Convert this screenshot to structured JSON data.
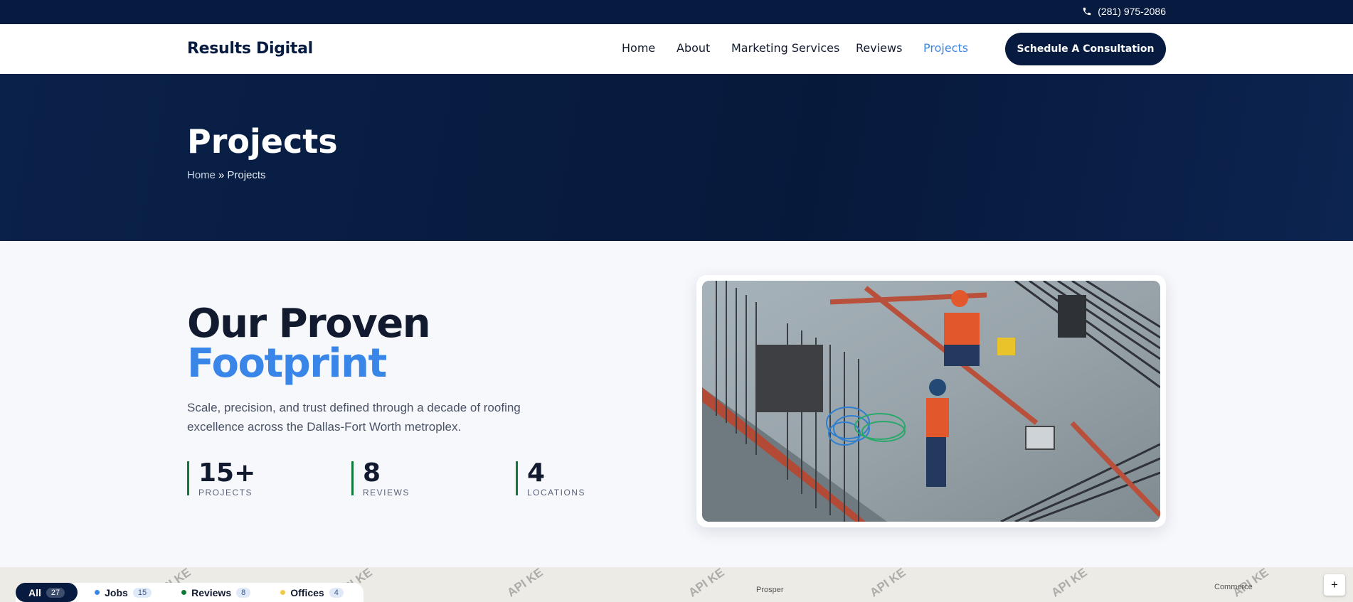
{
  "topbar": {
    "phone": "(281) 975-2086"
  },
  "header": {
    "logo": "Results Digital",
    "nav": [
      {
        "label": "Home"
      },
      {
        "label": "About"
      },
      {
        "label": "Marketing Services"
      },
      {
        "label": "Reviews"
      },
      {
        "label": "Projects",
        "active": true
      }
    ],
    "cta": "Schedule A Consultation"
  },
  "hero": {
    "title": "Projects",
    "breadcrumb": {
      "home": "Home",
      "separator": "»",
      "current": "Projects"
    }
  },
  "main": {
    "heading_line1": "Our Proven",
    "heading_line2": "Footprint",
    "description": "Scale, precision, and trust defined through a decade of roofing excellence across the Dallas-Fort Worth metroplex.",
    "stats": [
      {
        "value": "15+",
        "label": "PROJECTS"
      },
      {
        "value": "8",
        "label": "REVIEWS"
      },
      {
        "value": "4",
        "label": "LOCATIONS"
      }
    ]
  },
  "map": {
    "filters": [
      {
        "label": "All",
        "count": "27",
        "active": true
      },
      {
        "label": "Jobs",
        "count": "15",
        "dot": "#3a86e8"
      },
      {
        "label": "Reviews",
        "count": "8",
        "dot": "#0e7a3a"
      },
      {
        "label": "Offices",
        "count": "4",
        "dot": "#f2c94c"
      }
    ],
    "places": [
      "Prosper",
      "Commerce"
    ],
    "watermark": "API KE",
    "zoom_in": "+"
  },
  "colors": {
    "navy": "#071a3f",
    "accent": "#3a86e8",
    "green": "#0e7a3a"
  }
}
